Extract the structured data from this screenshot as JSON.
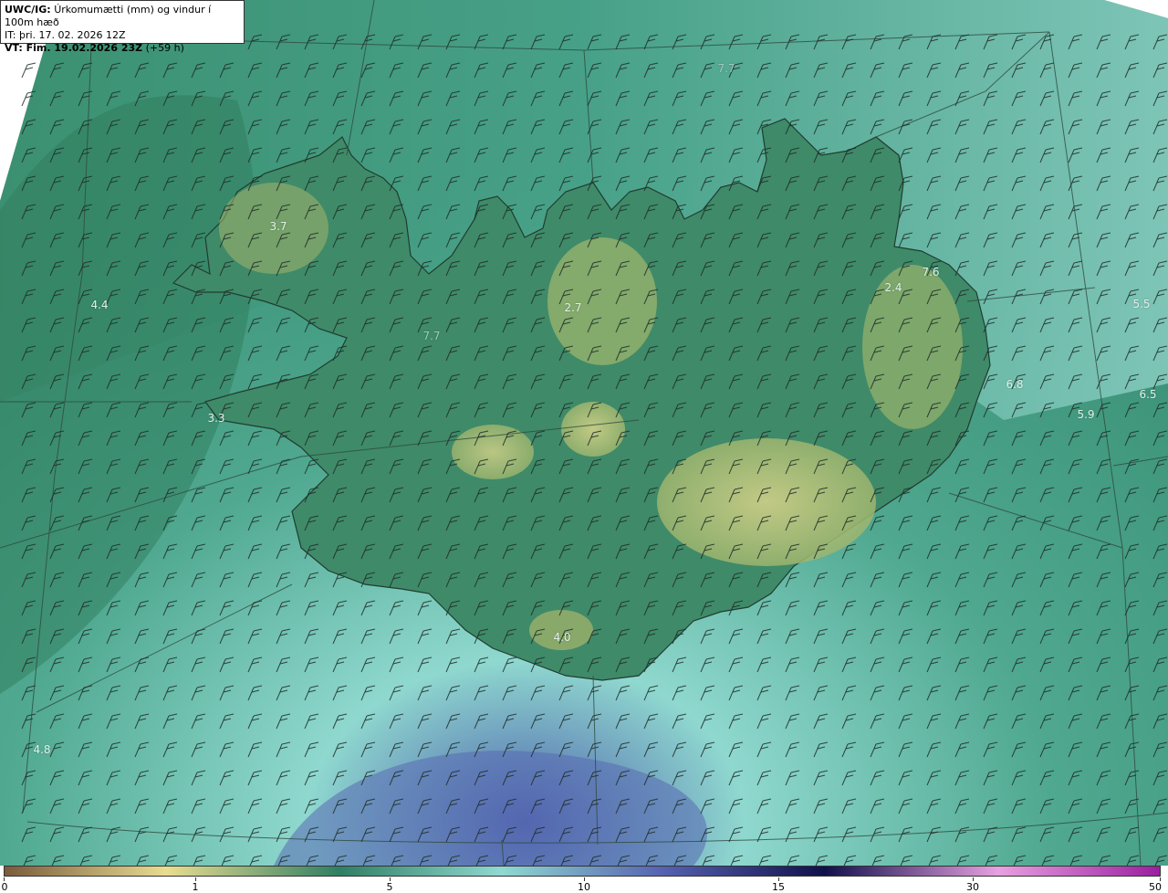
{
  "header": {
    "line1_bold": "UWC/IG:",
    "line1_rest": "Úrkomumætti (mm) og vindur í 100m hæð",
    "line2_bold": "IT:",
    "line2_rest": "þri. 17. 02. 2026 12Z",
    "line3_bold": "VT: Fim. 19.02.2026 23Z",
    "line3_rest": "(+59 h)"
  },
  "value_labels": [
    {
      "id": "v-3-7",
      "text": "3.7",
      "faint": false
    },
    {
      "id": "v-4-4",
      "text": "4.4",
      "faint": false
    },
    {
      "id": "v-7-7a",
      "text": "7.7",
      "faint": true
    },
    {
      "id": "v-2-7",
      "text": "2.7",
      "faint": false
    },
    {
      "id": "v-7-6",
      "text": "7.6",
      "faint": false
    },
    {
      "id": "v-2-4",
      "text": "2.4",
      "faint": false
    },
    {
      "id": "v-5-5",
      "text": "5.5",
      "faint": false
    },
    {
      "id": "v-6-8",
      "text": "6.8",
      "faint": false
    },
    {
      "id": "v-6-5",
      "text": "6.5",
      "faint": false
    },
    {
      "id": "v-5-9",
      "text": "5.9",
      "faint": false
    },
    {
      "id": "v-3-3",
      "text": "3.3",
      "faint": false
    },
    {
      "id": "v-7-7b",
      "text": "7.7",
      "faint": true
    },
    {
      "id": "v-4-0",
      "text": "4.0",
      "faint": false
    },
    {
      "id": "v-4-8",
      "text": "4.8",
      "faint": false
    }
  ],
  "scale": {
    "ticks": [
      "0",
      "1",
      "5",
      "10",
      "15",
      "30",
      "50"
    ],
    "colors": [
      "#7a5a3c",
      "#e9dd8f",
      "#2f7f63",
      "#8fd9d2",
      "#5562b0",
      "#10104a",
      "#e8a0e0",
      "#9a1fa0"
    ]
  }
}
